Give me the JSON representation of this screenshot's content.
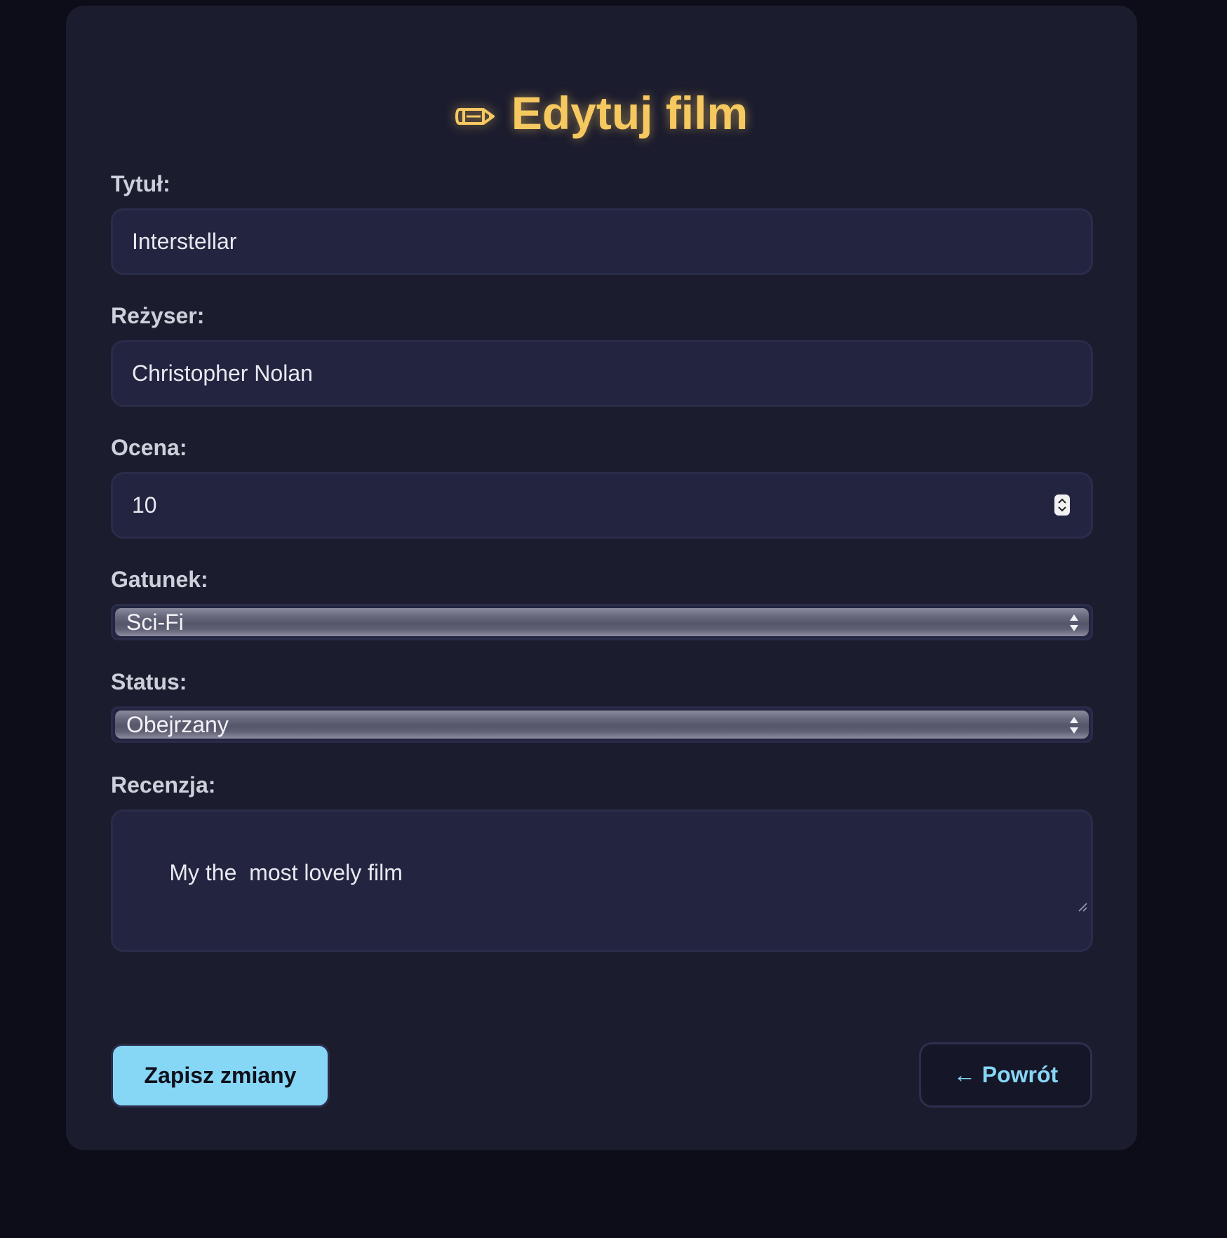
{
  "page": {
    "title": "Edytuj film",
    "title_icon": "pencil-icon"
  },
  "form": {
    "title": {
      "label": "Tytuł:",
      "value": "Interstellar"
    },
    "director": {
      "label": "Reżyser:",
      "value": "Christopher Nolan"
    },
    "rating": {
      "label": "Ocena:",
      "value": "10"
    },
    "genre": {
      "label": "Gatunek:",
      "selected": "Sci-Fi"
    },
    "status": {
      "label": "Status:",
      "selected": "Obejrzany"
    },
    "review": {
      "label": "Recenzja:",
      "value": "My the  most lovely film"
    }
  },
  "actions": {
    "save_label": "Zapisz zmiany",
    "back_label": "← Powrót"
  },
  "colors": {
    "background": "#0c0d19",
    "card": "#1b1c2e",
    "input_bg": "#232440",
    "accent_title": "#f6c860",
    "accent_button": "#86d6f5"
  }
}
